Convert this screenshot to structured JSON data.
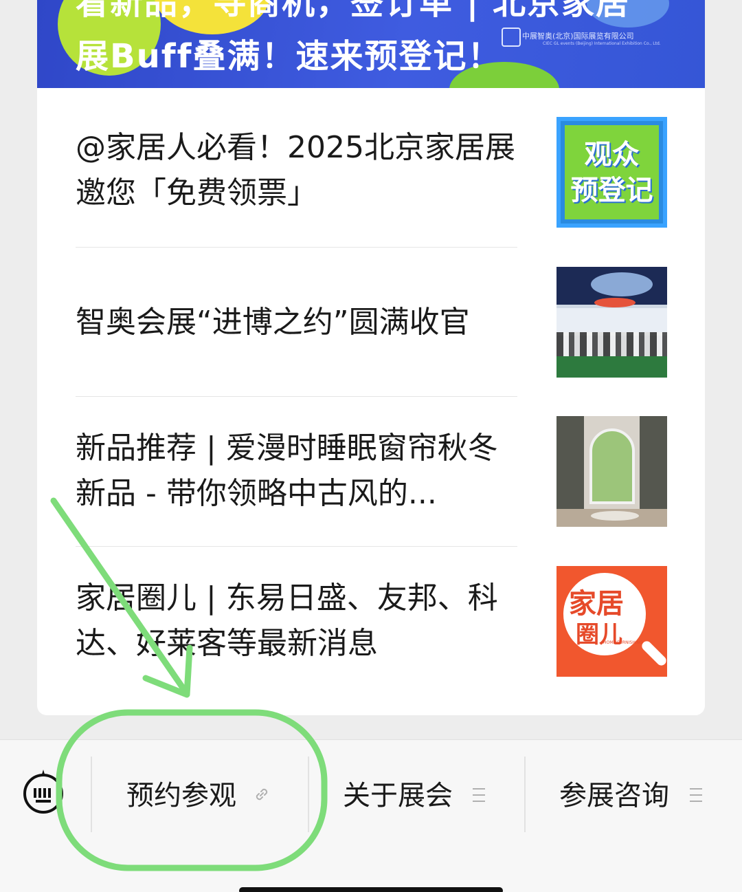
{
  "banner": {
    "line1": "看新品，寻商机，签订单 | 北京家居",
    "line2": "展Buff叠满！速来预登记！",
    "org_name": "中展智奥(北京)国际展览有限公司",
    "org_sub": "CIEC GL events (Beijing) International Exhibition Co., Ltd."
  },
  "articles": [
    {
      "title": "@家居人必看！2025北京家居展邀您「免费领票」",
      "thumb_text_1": "观众",
      "thumb_text_2": "预登记"
    },
    {
      "title": "智奥会展“进博之约”圆满收官"
    },
    {
      "title": "新品推荐 | 爱漫时睡眠窗帘秋冬新品 - 带你领略中古风的..."
    },
    {
      "title": "家居圈儿 | 东易日盛、友邦、科达、好莱客等最新消息",
      "thumb_text_1": "家居",
      "thumb_text_2": "圈儿",
      "thumb_text_3": "HOME FURNISHING"
    }
  ],
  "menu": {
    "items": [
      {
        "label": "预约参观",
        "icon": "link-icon"
      },
      {
        "label": "关于展会",
        "icon": "submenu-icon"
      },
      {
        "label": "参展咨询",
        "icon": "submenu-icon"
      }
    ],
    "keyboard_icon": "keyboard-icon"
  },
  "annotation": {
    "color": "#7edc7a"
  }
}
